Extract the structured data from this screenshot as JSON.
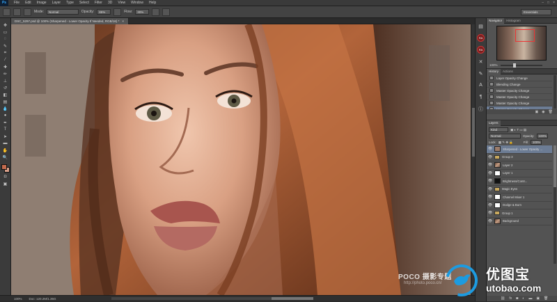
{
  "app": {
    "logo": "Ps"
  },
  "menu": [
    "File",
    "Edit",
    "Image",
    "Layer",
    "Type",
    "Select",
    "Filter",
    "3D",
    "View",
    "Window",
    "Help"
  ],
  "options": {
    "mode_label": "Mode:",
    "mode_value": "Normal",
    "opacity_label": "Opacity:",
    "opacity_value": "85%",
    "flow_label": "Flow:",
    "flow_value": "30%",
    "workspace": "Essentials"
  },
  "document": {
    "tab_title": "DSC_5297.psd @ 100% (Sharpened - Lower Opacity If Needed, RGB/16) *",
    "zoom": "100%",
    "doc_info": "Doc: 120.2M/1.35G"
  },
  "navigator": {
    "tabs": [
      "Navigator",
      "Histogram"
    ],
    "zoom": "100%"
  },
  "history": {
    "tabs": [
      "History",
      "Actions"
    ],
    "items": [
      "Layer Opacity Change",
      "Blending Change",
      "Master Opacity Change",
      "Master Opacity Change",
      "Master Opacity Change",
      "Master Opacity Change"
    ],
    "selected_index": 5
  },
  "layers": {
    "tabs": [
      "Layers"
    ],
    "kind_label": "Kind",
    "blend_mode": "Normal",
    "opacity_label": "Opacity:",
    "opacity_value": "100%",
    "lock_label": "Lock:",
    "fill_label": "Fill:",
    "fill_value": "100%",
    "items": [
      {
        "name": "Sharpened - Lower Opacity ...",
        "thumb": "gray",
        "selected": true
      },
      {
        "name": "Group 3",
        "thumb": "folder"
      },
      {
        "name": "Layer 2",
        "thumb": "photo"
      },
      {
        "name": "Layer 1",
        "thumb": "white"
      },
      {
        "name": "Brightness/Contr...",
        "thumb": "black"
      },
      {
        "name": "Magic Eyes",
        "thumb": "folder"
      },
      {
        "name": "Channel Mixer 1",
        "thumb": "white"
      },
      {
        "name": "Dodge & Burn",
        "thumb": "white"
      },
      {
        "name": "Group 1",
        "thumb": "folder"
      },
      {
        "name": "Background",
        "thumb": "photo"
      }
    ]
  },
  "watermark": {
    "text": "POCO 摄影专题",
    "sub": "http://photo.poco.cn/"
  },
  "site": {
    "cn": "优图宝",
    "en": "utobao.com"
  },
  "colors": {
    "foreground": "#c36a4d",
    "background": "#d9a08a",
    "accent": "#1d9be0",
    "selection": "#6c7c94"
  }
}
